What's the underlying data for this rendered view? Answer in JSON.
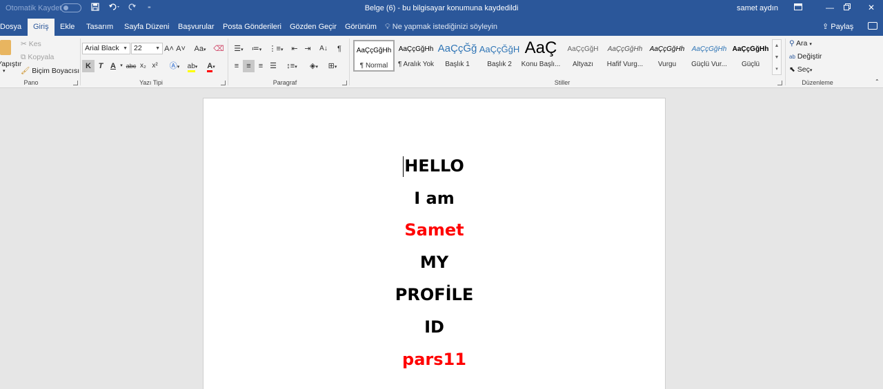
{
  "titlebar": {
    "autosave_label": "Otomatik Kaydet",
    "title": "Belge (6)  -  bu bilgisayar konumuna kaydedildi",
    "user": "samet aydın"
  },
  "tabs": [
    "Dosya",
    "Giriş",
    "Ekle",
    "Tasarım",
    "Sayfa Düzeni",
    "Başvurular",
    "Posta Gönderileri",
    "Gözden Geçir",
    "Görünüm"
  ],
  "active_tab": "Giriş",
  "tell_me": "Ne yapmak istediğinizi söyleyin",
  "share_label": "Paylaş",
  "clipboard": {
    "paste": "Yapıştır",
    "cut": "Kes",
    "copy": "Kopyala",
    "format_painter": "Biçim Boyacısı",
    "group": "Pano"
  },
  "font": {
    "name": "Arial Black",
    "size": "22",
    "group": "Yazı Tipi",
    "bold": "K",
    "italic": "T",
    "underline": "A",
    "strike": "abc",
    "subscript": "x₂",
    "superscript": "x²",
    "grow": "A˄",
    "shrink": "A˅",
    "case": "Aa",
    "font_color_accent": "#ff0000",
    "highlight_accent": "#ffff00"
  },
  "paragraph": {
    "group": "Paragraf",
    "pilcrow": "¶"
  },
  "styles": {
    "group": "Stiller",
    "items": [
      {
        "sample": "AaÇçĞğHh",
        "name": "¶ Normal"
      },
      {
        "sample": "AaÇçĞğHh",
        "name": "¶ Aralık Yok"
      },
      {
        "sample": "AaÇçĞğ",
        "name": "Başlık 1"
      },
      {
        "sample": "AaÇçĞğH",
        "name": "Başlık 2"
      },
      {
        "sample": "AaÇ",
        "name": "Konu Başlı..."
      },
      {
        "sample": "AaÇçĞğH",
        "name": "Altyazı"
      },
      {
        "sample": "AaÇçĞğHh",
        "name": "Hafif Vurg..."
      },
      {
        "sample": "AaÇçĞğHh",
        "name": "Vurgu"
      },
      {
        "sample": "AaÇçĞğHh",
        "name": "Güçlü Vur..."
      },
      {
        "sample": "AaÇçĞğHh",
        "name": "Güçlü"
      }
    ]
  },
  "editing": {
    "group": "Düzenleme",
    "find": "Ara",
    "replace": "Değiştir",
    "select": "Seç"
  },
  "document": {
    "lines": [
      {
        "text": "HELLO",
        "color": "#000000"
      },
      {
        "text": "I am",
        "color": "#000000"
      },
      {
        "text": "Samet",
        "color": "#ff0000"
      },
      {
        "text": "MY",
        "color": "#000000"
      },
      {
        "text": "PROFİLE",
        "color": "#000000"
      },
      {
        "text": "ID",
        "color": "#000000"
      },
      {
        "text": "pars11",
        "color": "#ff0000"
      }
    ]
  },
  "colors": {
    "accent": "#2b579a",
    "ribbon_bg": "#f3f3f3",
    "canvas_bg": "#e6e6e6"
  }
}
